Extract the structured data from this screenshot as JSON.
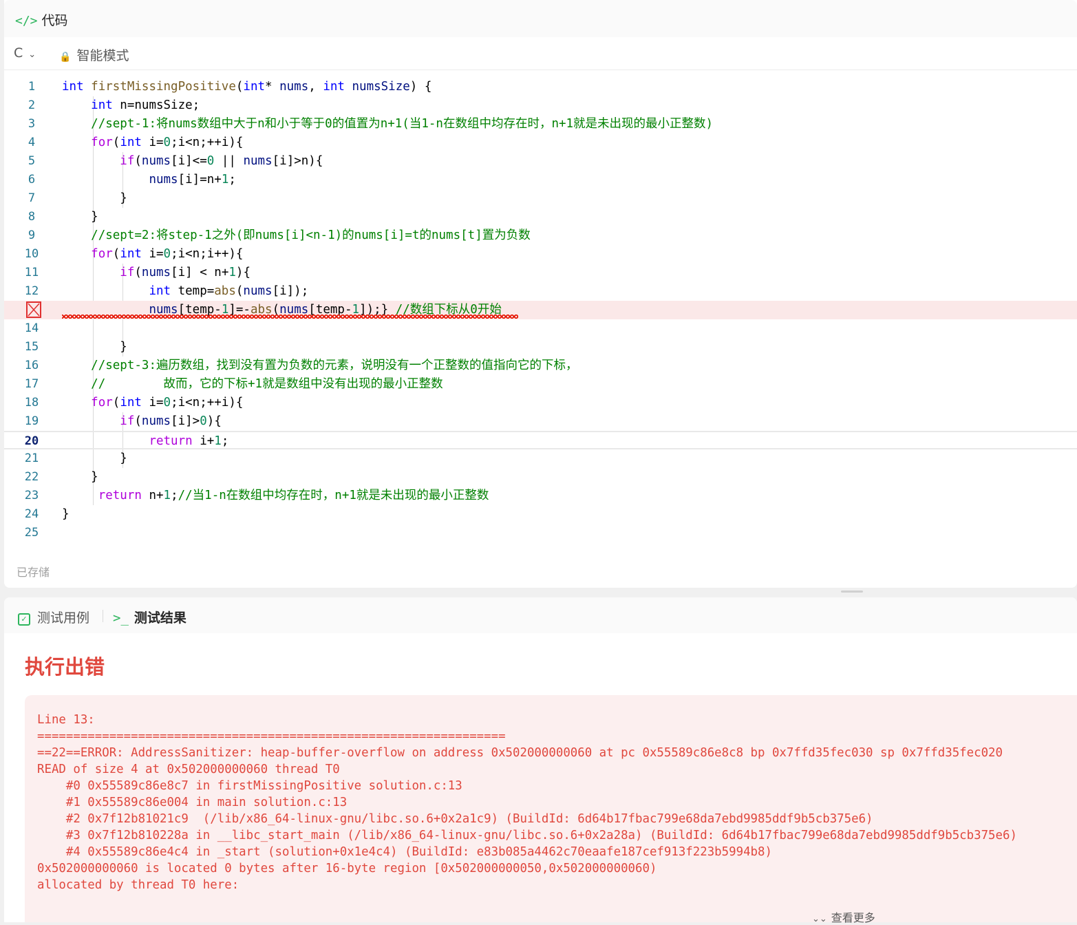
{
  "code_panel": {
    "title_icon": "</>",
    "title": "代码",
    "language": "C",
    "mode_label": "智能模式",
    "saved_label": "已存储",
    "error_line_number": 13,
    "current_line_number": 20
  },
  "code_lines": [
    [
      [
        "kw",
        "int"
      ],
      [
        "txt",
        " "
      ],
      [
        "fn",
        "firstMissingPositive"
      ],
      [
        "txt",
        "("
      ],
      [
        "kw",
        "int"
      ],
      [
        "txt",
        "* "
      ],
      [
        "var",
        "nums"
      ],
      [
        "txt",
        ", "
      ],
      [
        "kw",
        "int"
      ],
      [
        "txt",
        " "
      ],
      [
        "var",
        "numsSize"
      ],
      [
        "txt",
        ") {"
      ]
    ],
    [
      [
        "txt",
        "    "
      ],
      [
        "kw",
        "int"
      ],
      [
        "txt",
        " n=numsSize;"
      ]
    ],
    [
      [
        "txt",
        "    "
      ],
      [
        "cm",
        "//sept-1:将nums数组中大于n和小于等于0的值置为n+1(当1-n在数组中均存在时，n+1就是未出现的最小正整数)"
      ]
    ],
    [
      [
        "txt",
        "    "
      ],
      [
        "ctl",
        "for"
      ],
      [
        "txt",
        "("
      ],
      [
        "kw",
        "int"
      ],
      [
        "txt",
        " i="
      ],
      [
        "num",
        "0"
      ],
      [
        "txt",
        ";i<n;++i){"
      ]
    ],
    [
      [
        "txt",
        "        "
      ],
      [
        "ctl",
        "if"
      ],
      [
        "txt",
        "("
      ],
      [
        "var",
        "nums"
      ],
      [
        "txt",
        "[i]<="
      ],
      [
        "num",
        "0"
      ],
      [
        "txt",
        " || "
      ],
      [
        "var",
        "nums"
      ],
      [
        "txt",
        "[i]>n){"
      ]
    ],
    [
      [
        "txt",
        "            "
      ],
      [
        "var",
        "nums"
      ],
      [
        "txt",
        "[i]=n+"
      ],
      [
        "num",
        "1"
      ],
      [
        "txt",
        ";"
      ]
    ],
    [
      [
        "txt",
        "        }"
      ]
    ],
    [
      [
        "txt",
        "    }"
      ]
    ],
    [
      [
        "txt",
        "    "
      ],
      [
        "cm",
        "//sept=2:将step-1之外(即nums[i]<n-1)的nums[i]=t的nums[t]置为负数"
      ]
    ],
    [
      [
        "txt",
        "    "
      ],
      [
        "ctl",
        "for"
      ],
      [
        "txt",
        "("
      ],
      [
        "kw",
        "int"
      ],
      [
        "txt",
        " i="
      ],
      [
        "num",
        "0"
      ],
      [
        "txt",
        ";i<n;i++){"
      ]
    ],
    [
      [
        "txt",
        "        "
      ],
      [
        "ctl",
        "if"
      ],
      [
        "txt",
        "("
      ],
      [
        "var",
        "nums"
      ],
      [
        "txt",
        "[i] < n+"
      ],
      [
        "num",
        "1"
      ],
      [
        "txt",
        "){"
      ]
    ],
    [
      [
        "txt",
        "            "
      ],
      [
        "kw",
        "int"
      ],
      [
        "txt",
        " temp="
      ],
      [
        "fn",
        "abs"
      ],
      [
        "txt",
        "("
      ],
      [
        "var",
        "nums"
      ],
      [
        "txt",
        "[i]);"
      ]
    ],
    [
      [
        "txt",
        "            "
      ],
      [
        "var",
        "nums"
      ],
      [
        "txt",
        "[temp-"
      ],
      [
        "num",
        "1"
      ],
      [
        "txt",
        "]=-"
      ],
      [
        "fn",
        "abs"
      ],
      [
        "txt",
        "("
      ],
      [
        "var",
        "nums"
      ],
      [
        "txt",
        "[temp-"
      ],
      [
        "num",
        "1"
      ],
      [
        "txt",
        "]);} "
      ],
      [
        "cm",
        "//数组下标从0开始"
      ]
    ],
    [
      [
        "txt",
        ""
      ]
    ],
    [
      [
        "txt",
        "        }"
      ]
    ],
    [
      [
        "txt",
        "    "
      ],
      [
        "cm",
        "//sept-3:遍历数组，找到没有置为负数的元素，说明没有一个正整数的值指向它的下标，"
      ]
    ],
    [
      [
        "txt",
        "    "
      ],
      [
        "cm",
        "//        故而，它的下标+1就是数组中没有出现的最小正整数"
      ]
    ],
    [
      [
        "txt",
        "    "
      ],
      [
        "ctl",
        "for"
      ],
      [
        "txt",
        "("
      ],
      [
        "kw",
        "int"
      ],
      [
        "txt",
        " i="
      ],
      [
        "num",
        "0"
      ],
      [
        "txt",
        ";i<n;++i){"
      ]
    ],
    [
      [
        "txt",
        "        "
      ],
      [
        "ctl",
        "if"
      ],
      [
        "txt",
        "("
      ],
      [
        "var",
        "nums"
      ],
      [
        "txt",
        "[i]>"
      ],
      [
        "num",
        "0"
      ],
      [
        "txt",
        "){"
      ]
    ],
    [
      [
        "txt",
        "            "
      ],
      [
        "ctl",
        "return"
      ],
      [
        "txt",
        " i+"
      ],
      [
        "num",
        "1"
      ],
      [
        "txt",
        ";"
      ]
    ],
    [
      [
        "txt",
        "        }"
      ]
    ],
    [
      [
        "txt",
        "    }"
      ]
    ],
    [
      [
        "txt",
        "     "
      ],
      [
        "ctl",
        "return"
      ],
      [
        "txt",
        " n+"
      ],
      [
        "num",
        "1"
      ],
      [
        "txt",
        ";"
      ],
      [
        "cm",
        "//当1-n在数组中均存在时，n+1就是未出现的最小正整数"
      ]
    ],
    [
      [
        "txt",
        "}"
      ]
    ],
    [
      [
        "txt",
        ""
      ]
    ]
  ],
  "result_panel": {
    "tab_cases": "测试用例",
    "tab_result_icon": ">_",
    "tab_result": "测试结果",
    "status": "执行出错",
    "error_text": "Line 13: \n=================================================================\n==22==ERROR: AddressSanitizer: heap-buffer-overflow on address 0x502000000060 at pc 0x55589c86e8c8 bp 0x7ffd35fec030 sp 0x7ffd35fec020\nREAD of size 4 at 0x502000000060 thread T0\n    #0 0x55589c86e8c7 in firstMissingPositive solution.c:13\n    #1 0x55589c86e004 in main solution.c:13\n    #2 0x7f12b81021c9  (/lib/x86_64-linux-gnu/libc.so.6+0x2a1c9) (BuildId: 6d64b17fbac799e68da7ebd9985ddf9b5cb375e6)\n    #3 0x7f12b810228a in __libc_start_main (/lib/x86_64-linux-gnu/libc.so.6+0x2a28a) (BuildId: 6d64b17fbac799e68da7ebd9985ddf9b5cb375e6)\n    #4 0x55589c86e4c4 in _start (solution+0x1e4c4) (BuildId: e83b085a4462c70eaafe187cef913f223b5994b8)\n0x502000000060 is located 0 bytes after 16-byte region [0x502000000050,0x502000000060)\nallocated by thread T0 here:",
    "more_label": "查看更多"
  },
  "icons": {
    "lock": "lock-icon",
    "chevron": "chevron-down-icon",
    "error": "error-x-icon",
    "check": "checkbox-icon",
    "terminal": "terminal-icon"
  },
  "colors": {
    "accent_green": "#2db55d",
    "error_red": "#e0483e",
    "error_bg": "#fcefef",
    "keyword": "#0000ff",
    "control": "#af00db",
    "comment": "#008000"
  }
}
